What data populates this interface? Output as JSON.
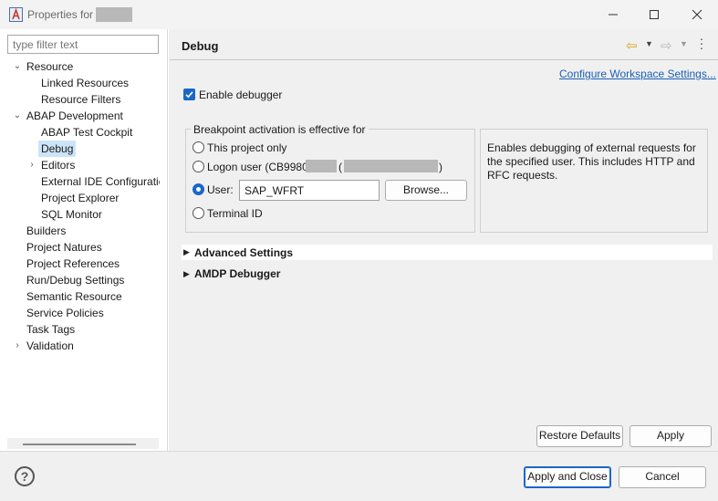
{
  "window": {
    "title": "Properties for",
    "minimize_icon": "minimize-icon",
    "maximize_icon": "maximize-icon",
    "close_icon": "close-icon"
  },
  "sidebar": {
    "filter_placeholder": "type filter text",
    "items": [
      {
        "label": "Resource",
        "expander": "expanded"
      },
      {
        "label": "Linked Resources"
      },
      {
        "label": "Resource Filters"
      },
      {
        "label": "ABAP Development",
        "expander": "expanded"
      },
      {
        "label": "ABAP Test Cockpit"
      },
      {
        "label": "Debug",
        "selected": true
      },
      {
        "label": "Editors",
        "expander": "collapsed"
      },
      {
        "label": "External IDE Configuratic"
      },
      {
        "label": "Project Explorer"
      },
      {
        "label": "SQL Monitor"
      },
      {
        "label": "Builders"
      },
      {
        "label": "Project Natures"
      },
      {
        "label": "Project References"
      },
      {
        "label": "Run/Debug Settings"
      },
      {
        "label": "Semantic Resource"
      },
      {
        "label": "Service Policies"
      },
      {
        "label": "Task Tags"
      },
      {
        "label": "Validation",
        "expander": "collapsed"
      }
    ]
  },
  "page": {
    "title": "Debug",
    "configure_link": "Configure Workspace Settings...",
    "enable_debugger": {
      "label": "Enable debugger",
      "checked": true
    },
    "breakpoint_group": {
      "label": "Breakpoint activation is effective for",
      "options": {
        "project": {
          "label": "This project only",
          "selected": false
        },
        "logon": {
          "label_prefix": "Logon user (CB99800",
          "label_mid": "(",
          "label_suffix": ")",
          "selected": false
        },
        "user": {
          "label": "User:",
          "selected": true,
          "value": "SAP_WFRT"
        },
        "terminal": {
          "label": "Terminal ID",
          "selected": false
        }
      },
      "browse_label": "Browse..."
    },
    "description": "Enables debugging of external requests for the specified user. This includes HTTP and RFC requests.",
    "sections": {
      "advanced": "Advanced Settings",
      "amdp": "AMDP Debugger"
    },
    "restore_defaults_label": "Restore Defaults",
    "apply_label": "Apply"
  },
  "footer": {
    "apply_close_label": "Apply and Close",
    "cancel_label": "Cancel"
  },
  "colors": {
    "accent": "#1a66c9",
    "link": "#1a5fb4",
    "selection": "#cce4f7",
    "back_arrow": "#d9a21b"
  }
}
